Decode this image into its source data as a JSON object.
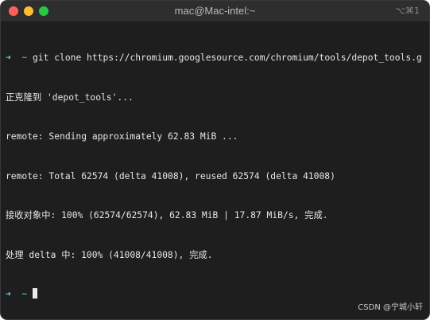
{
  "window": {
    "title": "mac@Mac-intel:~",
    "shortcut": "⌥⌘1"
  },
  "terminal": {
    "prompt_arrow": "➜",
    "prompt_dir": "~",
    "command": "git clone https://chromium.googlesource.com/chromium/tools/depot_tools.git",
    "output": [
      "正克隆到 'depot_tools'...",
      "remote: Sending approximately 62.83 MiB ...",
      "remote: Total 62574 (delta 41008), reused 62574 (delta 41008)",
      "接收对象中: 100% (62574/62574), 62.83 MiB | 17.87 MiB/s, 完成.",
      "处理 delta 中: 100% (41008/41008), 完成."
    ]
  },
  "watermark": "CSDN @宁城小轩",
  "colors": {
    "background": "#1e1e1e",
    "titlebar": "#2e2e2e",
    "text": "#e6e6e6",
    "prompt": "#5fd7ff",
    "close": "#ff5f57",
    "minimize": "#febc2e",
    "zoom": "#28c840"
  }
}
